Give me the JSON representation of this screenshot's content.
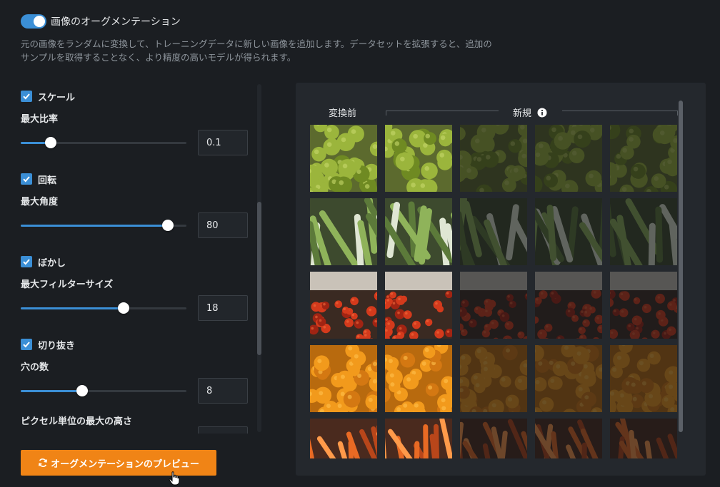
{
  "header": {
    "toggle_label": "画像のオーグメンテーション",
    "toggle_on": true,
    "description_line1": "元の画像をランダムに変換して、トレーニングデータに新しい画像を追加します。データセットを拡張すると、追加の",
    "description_line2": "サンプルを取得することなく、より精度の高いモデルが得られます。"
  },
  "settings": {
    "scale": {
      "label": "スケール",
      "checked": true,
      "param_label": "最大比率",
      "value": "0.1",
      "slider_fraction": 0.18
    },
    "rotation": {
      "label": "回転",
      "checked": true,
      "param_label": "最大角度",
      "value": "80",
      "slider_fraction": 0.89
    },
    "blur": {
      "label": "ぼかし",
      "checked": true,
      "param_label": "最大フィルターサイズ",
      "value": "18",
      "slider_fraction": 0.62
    },
    "cutout": {
      "label": "切り抜き",
      "checked": true,
      "param_label": "穴の数",
      "value": "8",
      "slider_fraction": 0.37
    },
    "max_height_label": "ピクセル単位の最大の高さ"
  },
  "preview_button": {
    "label": "オーグメンテーションのプレビュー",
    "icon": "refresh-icon"
  },
  "preview": {
    "before_label": "変換前",
    "new_label": "新規",
    "info_icon": "info-icon",
    "rows": [
      {
        "subject": "green-apples",
        "colors": {
          "bg": "#5c6a2e",
          "fruit": "#9bb53c",
          "shade": "#6f8a22",
          "accent": "#c7d86a"
        }
      },
      {
        "subject": "leeks",
        "colors": {
          "bg": "#3d4a2e",
          "fruit": "#dfe6d3",
          "shade": "#5c7a3a",
          "accent": "#8fb35a"
        }
      },
      {
        "subject": "tomatoes",
        "colors": {
          "bg": "#3a2a22",
          "fruit": "#d43a1c",
          "shade": "#a12413",
          "accent": "#f06a3c"
        }
      },
      {
        "subject": "oranges",
        "colors": {
          "bg": "#b86a0e",
          "fruit": "#f29a1c",
          "shade": "#d47812",
          "accent": "#ffc14d"
        }
      },
      {
        "subject": "carrots",
        "colors": {
          "bg": "#4a2a1e",
          "fruit": "#e86a24",
          "shade": "#b8461a",
          "accent": "#ff9a4a"
        }
      }
    ]
  }
}
